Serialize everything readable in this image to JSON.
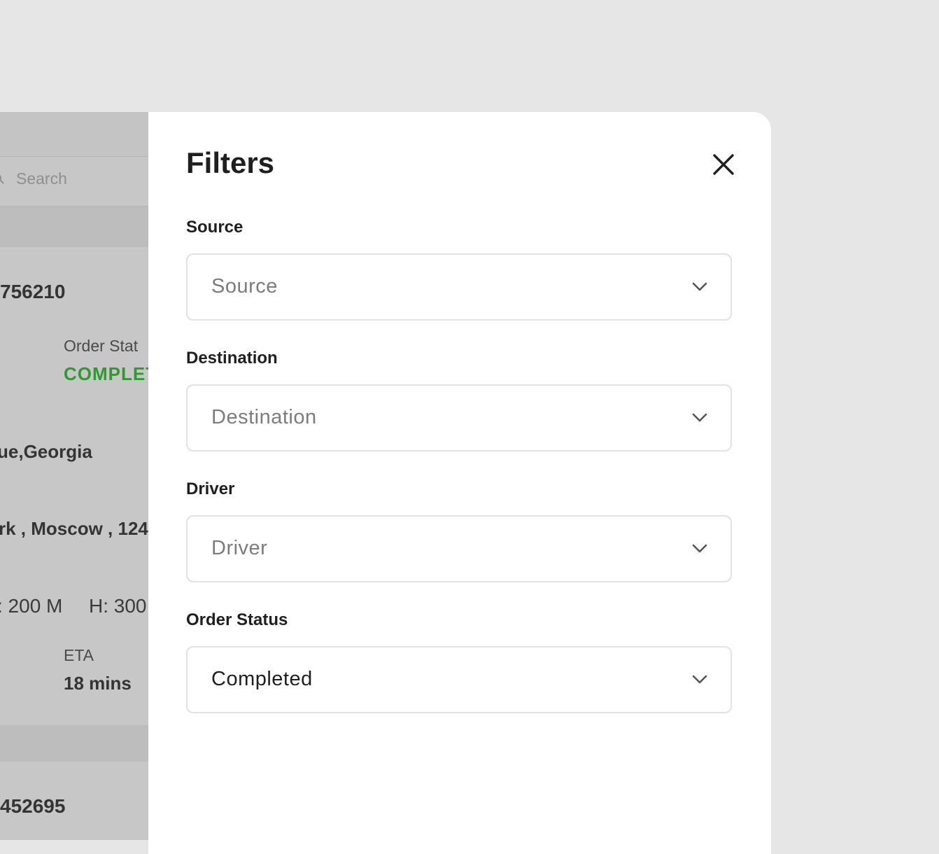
{
  "background_list": {
    "search_placeholder": "Search",
    "orders": [
      {
        "order_id_fragment": "756210",
        "status_label": "Order Stat",
        "status_value": "COMPLET",
        "address_line_1": "ue,Georgia",
        "address_line_2": "rk , Moscow , 124",
        "dimension_1": ": 200 M",
        "dimension_2": "H: 300",
        "eta_label": "ETA",
        "eta_value": "18 mins"
      },
      {
        "order_id_fragment": "452695"
      }
    ]
  },
  "filters_modal": {
    "title": "Filters",
    "close_icon": "close-icon",
    "fields": [
      {
        "label": "Source",
        "value": "",
        "placeholder": "Source",
        "icon": "chevron-down-icon"
      },
      {
        "label": "Destination",
        "value": "",
        "placeholder": "Destination",
        "icon": "chevron-down-icon"
      },
      {
        "label": "Driver",
        "value": "",
        "placeholder": "Driver",
        "icon": "chevron-down-icon"
      },
      {
        "label": "Order Status",
        "value": "Completed",
        "placeholder": "",
        "icon": "chevron-down-icon"
      }
    ]
  },
  "colors": {
    "backdrop": "#e6e6e6",
    "dimmed_panel": "#c7c7c7",
    "status_green": "#2f9a2f",
    "modal_background": "#ffffff",
    "input_border": "#e2e2e2",
    "placeholder_text": "#7c7c7c",
    "primary_text": "#1f1f1f"
  }
}
